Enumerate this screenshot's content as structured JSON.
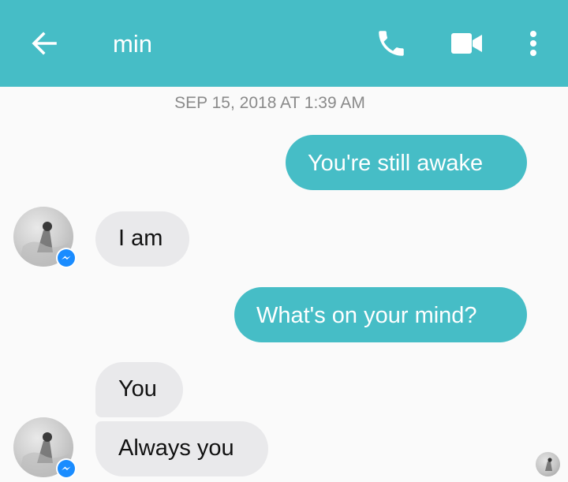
{
  "header": {
    "title": "min",
    "back_icon": "arrow-left-icon",
    "call_icon": "phone-icon",
    "video_icon": "video-camera-icon",
    "more_icon": "more-vertical-icon",
    "background": "#46bdc6"
  },
  "conversation": {
    "timestamp": "SEP 15, 2018 AT 1:39 AM",
    "messages": [
      {
        "from": "me",
        "text": "You're still awake"
      },
      {
        "from": "min",
        "text": "I am"
      },
      {
        "from": "me",
        "text": "What's on your mind?"
      },
      {
        "from": "min",
        "text": "You"
      },
      {
        "from": "min",
        "text": "Always you"
      }
    ]
  },
  "colors": {
    "outgoing_bubble": "#46bdc6",
    "incoming_bubble": "#e9e9eb",
    "messenger_badge": "#1a8cff"
  }
}
